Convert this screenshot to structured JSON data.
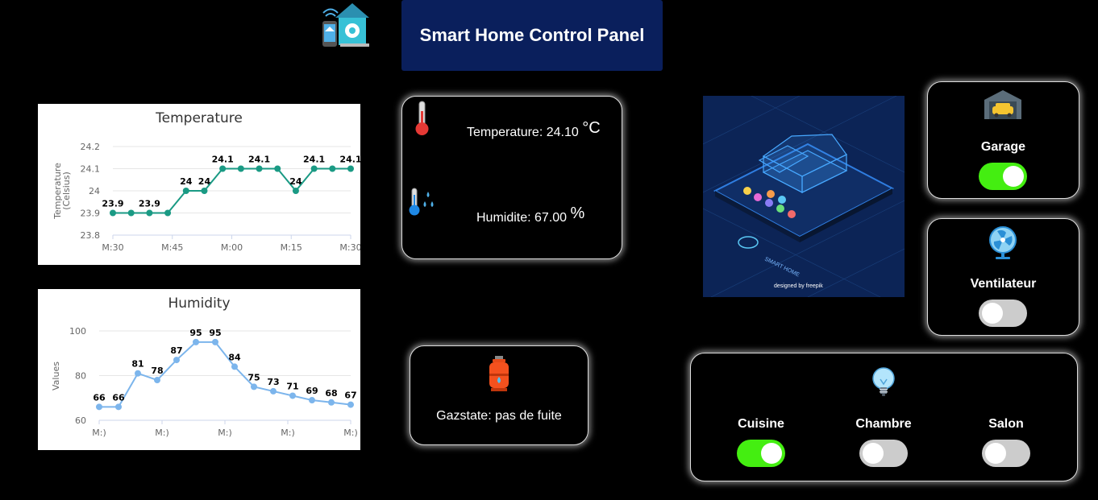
{
  "header": {
    "title": "Smart Home Control Panel",
    "logo_icon": "smart-home-logo-icon"
  },
  "sensor_card": {
    "temp_label": "Temperature:",
    "temp_value": "24.10",
    "temp_unit": "°C",
    "hum_label": "Humidite:",
    "hum_value": "67.00",
    "hum_unit": "%"
  },
  "gas_card": {
    "text": "Gazstate: pas de fuite",
    "icon": "gas-cylinder-icon"
  },
  "devices": {
    "garage": {
      "label": "Garage",
      "on": true,
      "icon": "garage-car-icon"
    },
    "ventilateur": {
      "label": "Ventilateur",
      "on": false,
      "icon": "fan-icon"
    },
    "lights": {
      "icon": "light-bulb-icon",
      "items": [
        {
          "label": "Cuisine",
          "on": true
        },
        {
          "label": "Chambre",
          "on": false
        },
        {
          "label": "Salon",
          "on": false
        }
      ]
    }
  },
  "banner": {
    "caption": "SMART HOME",
    "credit": "designed by freepik"
  },
  "chart_data": [
    {
      "type": "line",
      "title": "Temperature",
      "ylabel": "Temperature (Celsius)",
      "ylim": [
        23.8,
        24.2
      ],
      "yticks": [
        "24.2",
        "24.1",
        "24",
        "23.9",
        "23.8"
      ],
      "xticks": [
        "M:30",
        "M:45",
        "M:00",
        "M:15",
        "M:30"
      ],
      "values": [
        23.9,
        23.9,
        23.9,
        23.9,
        24,
        24,
        24.1,
        24.1,
        24.1,
        24.1,
        24,
        24.1,
        24.1,
        24.1
      ],
      "labels": [
        "23.9",
        "",
        "23.9",
        "",
        "24",
        "24",
        "24.1",
        "",
        "24.1",
        "",
        "24",
        "24.1",
        "",
        "24.1"
      ],
      "color": "#1a9a84"
    },
    {
      "type": "line",
      "title": "Humidity",
      "ylabel": "Values",
      "ylim": [
        60,
        100
      ],
      "yticks": [
        "100",
        "80",
        "60"
      ],
      "xticks": [
        "M:)",
        "M:)",
        "M:)",
        "M:)",
        "M:)"
      ],
      "values": [
        66,
        66,
        81,
        78,
        87,
        95,
        95,
        84,
        75,
        73,
        71,
        69,
        68,
        67
      ],
      "labels": [
        "66",
        "66",
        "81",
        "78",
        "87",
        "95",
        "95",
        "84",
        "75",
        "73",
        "71",
        "69",
        "68",
        "67"
      ],
      "color": "#7cb5ec"
    }
  ]
}
